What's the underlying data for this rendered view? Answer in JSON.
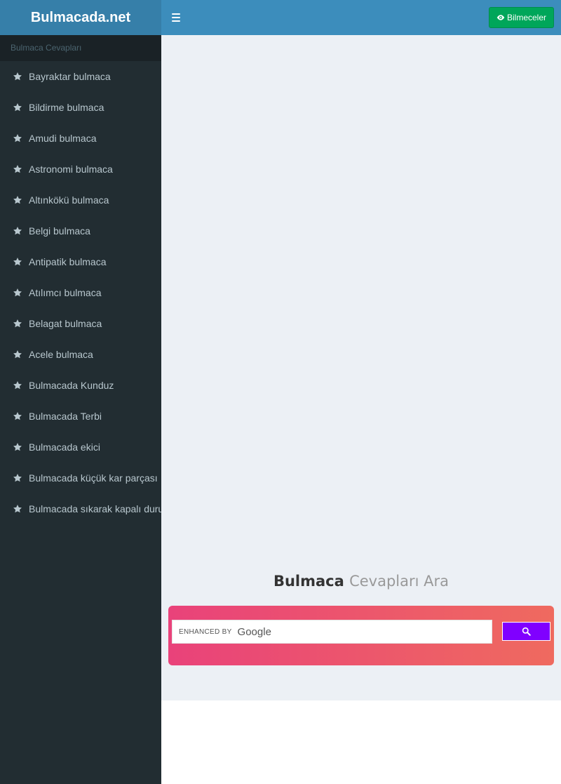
{
  "header": {
    "logo": "Bulmacada.net",
    "riddles_button": "Bilmeceler"
  },
  "sidebar": {
    "header": "Bulmaca Cevapları",
    "items": [
      {
        "label": "Bayraktar bulmaca"
      },
      {
        "label": "Bildirme bulmaca"
      },
      {
        "label": "Amudi bulmaca"
      },
      {
        "label": "Astronomi bulmaca"
      },
      {
        "label": "Altınkökü bulmaca"
      },
      {
        "label": "Belgi bulmaca"
      },
      {
        "label": "Antipatik bulmaca"
      },
      {
        "label": "Atılımcı bulmaca"
      },
      {
        "label": "Belagat bulmaca"
      },
      {
        "label": "Acele bulmaca"
      },
      {
        "label": "Bulmacada Kunduz"
      },
      {
        "label": "Bulmacada Terbi"
      },
      {
        "label": "Bulmacada ekici"
      },
      {
        "label": "Bulmacada küçük kar parçası"
      },
      {
        "label": "Bulmacada sıkarak kapalı durum"
      }
    ]
  },
  "search": {
    "title_strong": "Bulmaca",
    "title_light": "Cevapları Ara",
    "enhanced_by": "ENHANCED BY",
    "google": "Google"
  },
  "colors": {
    "header": "#3c8dbc",
    "logo_bg": "#367fa9",
    "sidebar": "#222d32",
    "button_green": "#00a65a",
    "search_button": "#8000ff",
    "content_bg": "#ecf0f5"
  },
  "icons": {
    "menu_toggle": "hamburger-icon",
    "riddles": "eye-icon",
    "menu_item": "star-icon",
    "search": "search-icon"
  }
}
